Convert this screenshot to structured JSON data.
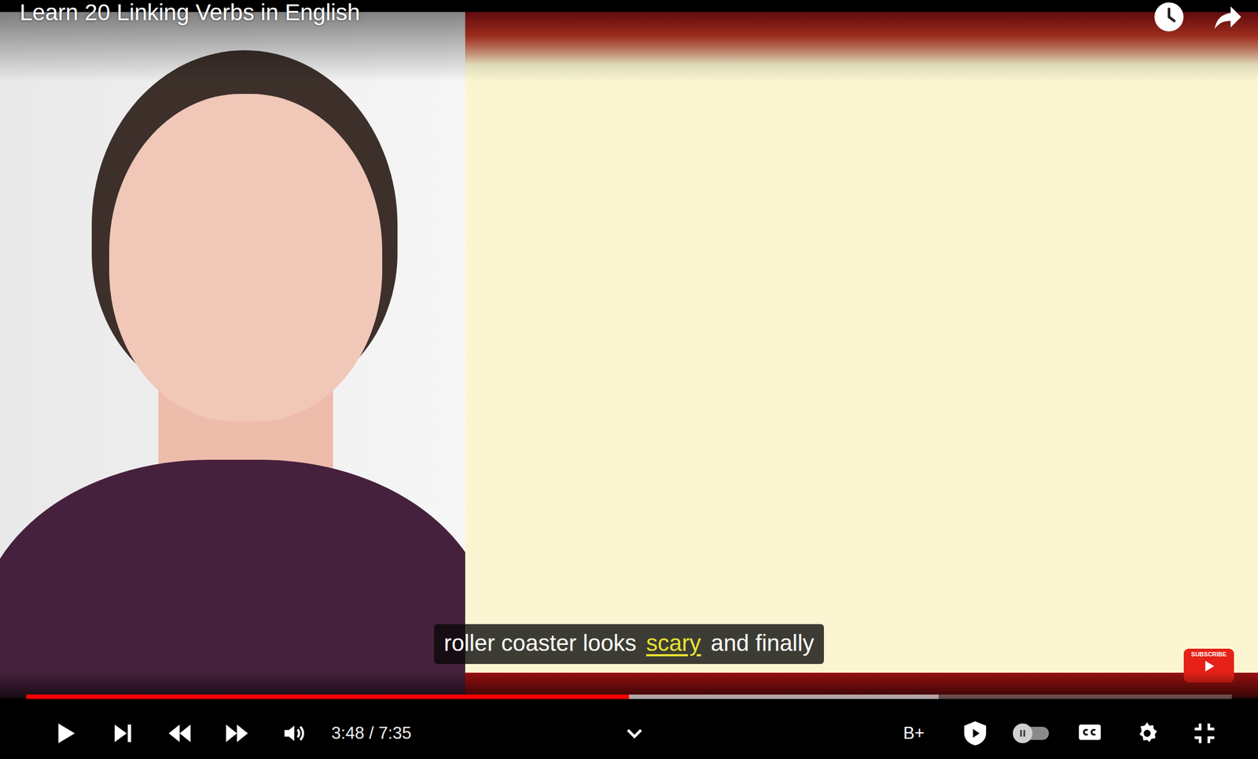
{
  "video": {
    "title": "Learn 20 Linking Verbs in English"
  },
  "captions": {
    "segments": [
      {
        "text": "roller coaster looks",
        "highlighted": false
      },
      {
        "text": "scary",
        "highlighted": true
      },
      {
        "text": "and finally",
        "highlighted": false
      }
    ]
  },
  "watermark": {
    "label": "SUBSCRIBE"
  },
  "progress": {
    "level": 0.5,
    "buffered_level": 0.757
  },
  "controls": {
    "paused": true,
    "time": "3:48 / 7:35",
    "extension_label": "B+",
    "autoplay": false,
    "captions_on": false
  }
}
